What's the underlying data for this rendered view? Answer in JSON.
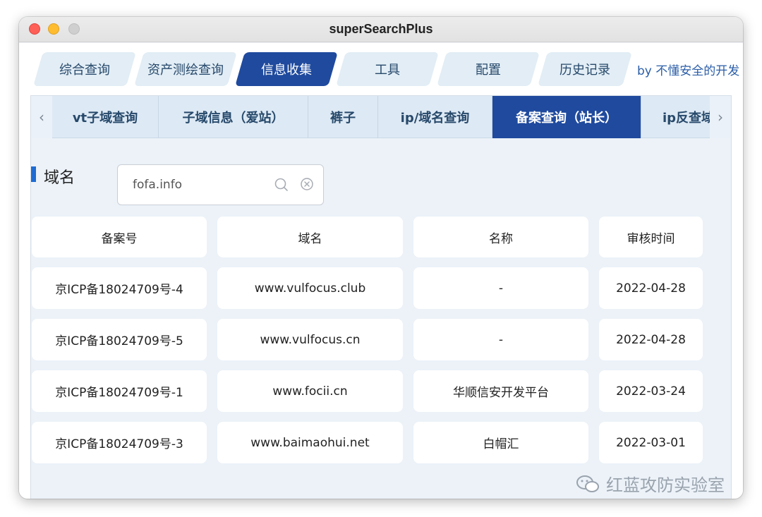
{
  "window": {
    "title": "superSearchPlus"
  },
  "top_tabs": [
    "综合查询",
    "资产测绘查询",
    "信息收集",
    "工具",
    "配置",
    "历史记录"
  ],
  "top_tab_active": "信息收集",
  "byline": "by 不懂安全的开发",
  "sub_tabs": [
    "vt子域查询",
    "子域信息（爱站）",
    "裤子",
    "ip/域名查询",
    "备案查询（站长）",
    "ip反查域"
  ],
  "sub_tab_active": "备案查询（站长）",
  "query": {
    "label": "域名",
    "value": "fofa.info"
  },
  "table": {
    "headers": [
      "备案号",
      "域名",
      "名称",
      "审核时间"
    ],
    "rows": [
      [
        "京ICP备18024709号-4",
        "www.vulfocus.club",
        "-",
        "2022-04-28"
      ],
      [
        "京ICP备18024709号-5",
        "www.vulfocus.cn",
        "-",
        "2022-04-28"
      ],
      [
        "京ICP备18024709号-1",
        "www.focii.cn",
        "华顺信安开发平台",
        "2022-03-24"
      ],
      [
        "京ICP备18024709号-3",
        "www.baimaohui.net",
        "白帽汇",
        "2022-03-01"
      ]
    ]
  },
  "watermark": "红蓝攻防实验室"
}
